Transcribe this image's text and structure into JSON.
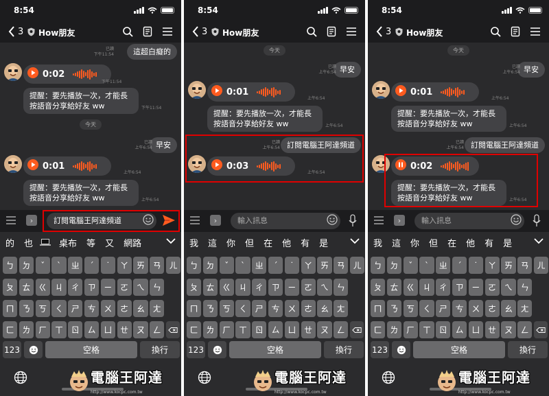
{
  "status": {
    "time": "8:54"
  },
  "header": {
    "back_count": "3",
    "title": "How朋友"
  },
  "panels": [
    {
      "messages": {
        "out1": "這超白癡的",
        "out1_read": "已讀",
        "out1_time": "下午11:54",
        "voice1_dur": "0:02",
        "voice1_time": "下午11:54",
        "note1": "提醒：要先播放一次，才能長按語音分享給好友 ww",
        "note1_time": "下午11:54",
        "date": "今天",
        "out2": "早安",
        "out2_read": "已讀",
        "out2_time": "上午6:54",
        "voice2_dur": "0:01",
        "voice2_time": "上午6:54",
        "note2": "提醒：要先播放一次，才能長按語音分享給好友 ww",
        "note2_time": "上午6:54"
      },
      "input": {
        "value": "訂閱電腦王阿達頻道"
      },
      "suggestions": [
        "的",
        "也",
        "桌布",
        "等",
        "又",
        "網路"
      ]
    },
    {
      "messages": {
        "date": "今天",
        "out2": "早安",
        "out2_read": "已讀",
        "out2_time": "上午6:54",
        "voice2_dur": "0:01",
        "voice2_time": "上午6:54",
        "note2": "提醒：要先播放一次，才能長按語音分享給好友 ww",
        "note2_time": "上午6:54",
        "out3": "訂閱電腦王阿達頻道",
        "out3_read": "已讀",
        "out3_time": "上午6:54",
        "voice3_dur": "0:03",
        "voice3_time": "上午6:54"
      },
      "input": {
        "placeholder": "輸入訊息"
      },
      "suggestions": [
        "我",
        "這",
        "你",
        "但",
        "在",
        "他",
        "有",
        "是"
      ]
    },
    {
      "messages": {
        "date": "今天",
        "out2": "早安",
        "out2_read": "已讀",
        "out2_time": "上午6:54",
        "voice2_dur": "0:01",
        "voice2_time": "上午6:54",
        "note2": "提醒：要先播放一次，才能長按語音分享給好友 ww",
        "note2_time": "上午6:54",
        "out3": "訂閱電腦王阿達頻道",
        "out3_read": "已讀",
        "out3_time": "上午6:54",
        "voice3_dur": "0:02",
        "note3": "提醒：要先播放一次，才能長按語音分享給好友 ww",
        "note3_time": "上午6:54"
      },
      "input": {
        "placeholder": "輸入訊息"
      },
      "suggestions": [
        "我",
        "這",
        "你",
        "但",
        "在",
        "他",
        "有",
        "是"
      ]
    }
  ],
  "keyboard": {
    "row1": [
      "ㄅ",
      "ㄉ",
      "ˇ",
      "ˋ",
      "ㄓ",
      "ˊ",
      "˙",
      "ㄚ",
      "ㄞ",
      "ㄢ",
      "ㄦ"
    ],
    "row2": [
      "ㄆ",
      "ㄊ",
      "ㄍ",
      "ㄐ",
      "ㄔ",
      "ㄗ",
      "ㄧ",
      "ㄛ",
      "ㄟ",
      "ㄣ"
    ],
    "row3": [
      "ㄇ",
      "ㄋ",
      "ㄎ",
      "ㄑ",
      "ㄕ",
      "ㄘ",
      "ㄨ",
      "ㄜ",
      "ㄠ",
      "ㄤ"
    ],
    "row4": [
      "ㄈ",
      "ㄌ",
      "ㄏ",
      "ㄒ",
      "ㄖ",
      "ㄙ",
      "ㄩ",
      "ㄝ",
      "ㄡ",
      "ㄥ"
    ],
    "num_key": "123",
    "space_key": "空格",
    "return_key": "換行"
  },
  "watermark": {
    "text": "電腦王阿達",
    "url": "http://www.kocpc.com.tw"
  },
  "colors": {
    "accent": "#ff5b1f",
    "highlight_box": "#e00000"
  }
}
